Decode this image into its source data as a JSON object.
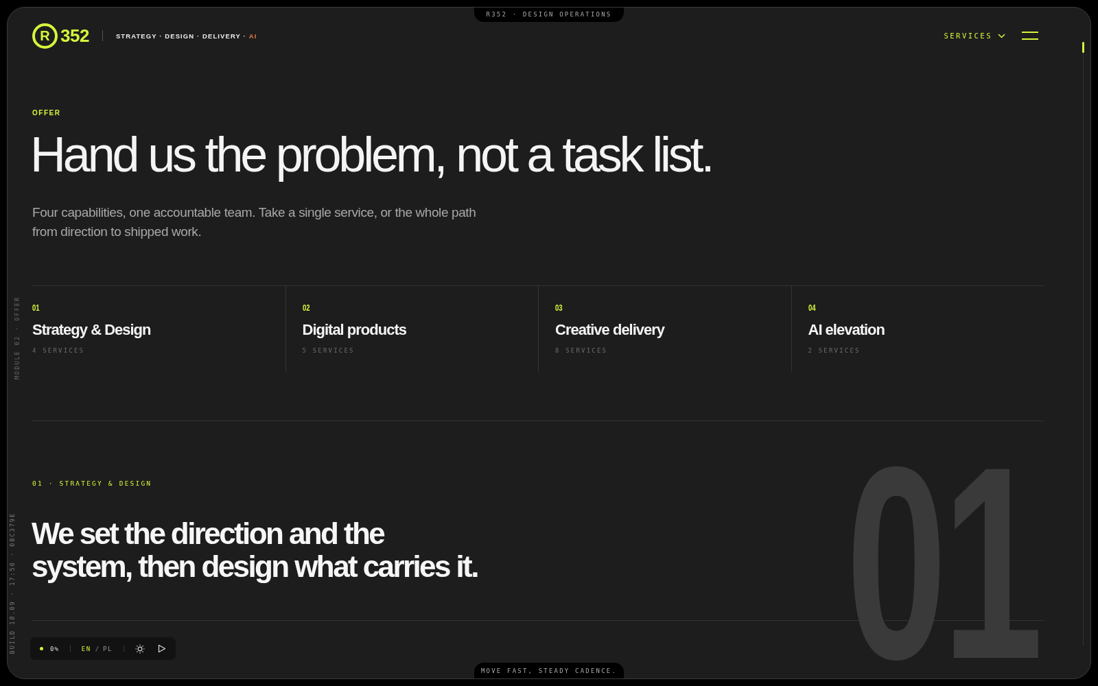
{
  "top_notch": "R352 · DESIGN OPERATIONS",
  "header": {
    "logo_mark": "R",
    "logo_text": "352",
    "tagline": "STRATEGY · DESIGN · DELIVERY ·",
    "tagline_accent": "AI",
    "nav": "SERVICES"
  },
  "side_labels": [
    "MODULE 02 · OFFER",
    "BUILD 18.09 · 17:50 · 0BC379E"
  ],
  "offer": {
    "eyebrow": "OFFER",
    "title": "Hand us the problem, not a task list.",
    "lead": "Four capabilities, one accountable team. Take a single service, or the whole path from direction to shipped work."
  },
  "capabilities": [
    {
      "number": "01",
      "title": "Strategy & Design",
      "count": "4 SERVICES"
    },
    {
      "number": "02",
      "title": "Digital products",
      "count": "5 SERVICES"
    },
    {
      "number": "03",
      "title": "Creative delivery",
      "count": "8 SERVICES"
    },
    {
      "number": "04",
      "title": "AI elevation",
      "count": "2 SERVICES"
    }
  ],
  "section": {
    "eyebrow": "01 · STRATEGY & DESIGN",
    "title_lines": [
      "We set the direction and the",
      "system, then design what carries it."
    ],
    "big_number": "01"
  },
  "toolbar": {
    "progress": "0%",
    "languages": [
      {
        "label": "EN",
        "selected": true
      },
      {
        "label": "PL",
        "selected": false
      }
    ],
    "separator": "/"
  },
  "bottom_notch": "MOVE FAST, STEADY CADENCE."
}
